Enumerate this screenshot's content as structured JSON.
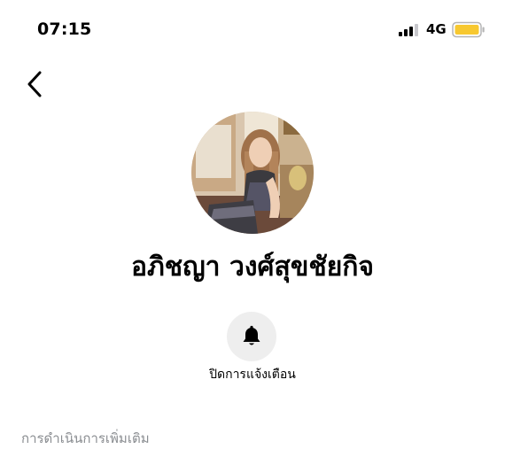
{
  "status_bar": {
    "time": "07:15",
    "network": "4G",
    "battery_color": "#f7c830",
    "signal_icon": "cellular-signal-icon",
    "battery_icon": "battery-icon"
  },
  "header": {
    "back_icon": "chevron-left-icon"
  },
  "profile": {
    "name": "อภิชญา วงศ์สุขชัยกิจ"
  },
  "actions": {
    "mute_label": "ปิดการแจ้งเตือน",
    "mute_icon": "bell-icon"
  },
  "section": {
    "more_actions_title": "การดำเนินการเพิ่มเติม"
  }
}
